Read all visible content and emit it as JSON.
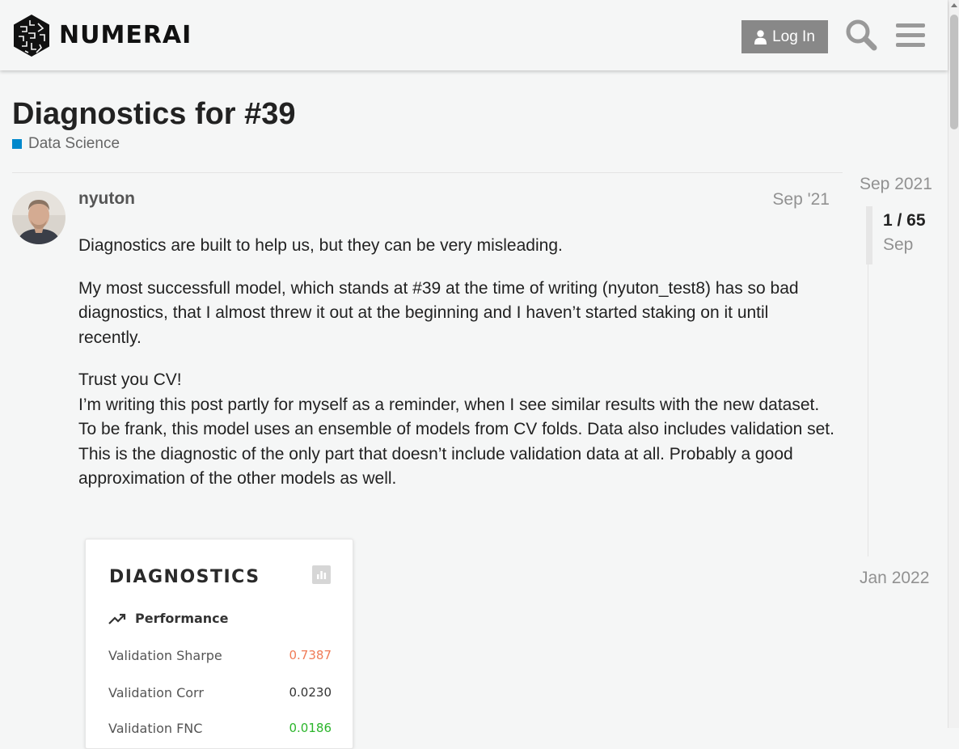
{
  "header": {
    "logo_text": "NUMERAI",
    "login_label": "Log In",
    "icons": {
      "login": "user-icon",
      "search": "search-icon",
      "menu": "hamburger-menu-icon"
    }
  },
  "topic": {
    "title": "Diagnostics for #39",
    "category": "Data Science",
    "category_color": "#0088cc"
  },
  "post": {
    "author": "nyuton",
    "date": "Sep '21",
    "paragraphs": [
      "Diagnostics are built to help us, but they can be very misleading.",
      "My most successfull model, which stands at #39 at the time of writing (nyuton_test8) has so bad diagnostics, that I almost threw it out at the beginning and I haven’t started staking on it until recently."
    ],
    "lines": [
      "Trust you CV!",
      "I’m writing this post partly for myself as a reminder, when I see similar results with the new dataset.",
      "To be frank, this model uses an ensemble of models from CV folds. Data also includes validation set. This is the diagnostic of the only part that doesn’t include validation data at all. Probably a good approximation of the other models as well."
    ]
  },
  "diagnostics": {
    "title": "DIAGNOSTICS",
    "section": "Performance",
    "rows": [
      {
        "label": "Validation Sharpe",
        "value": "0.7387",
        "color": "#f07b57"
      },
      {
        "label": "Validation Corr",
        "value": "0.0230",
        "color": "#333333"
      },
      {
        "label": "Validation FNC",
        "value": "0.0186",
        "color": "#2bb52b"
      }
    ]
  },
  "timeline": {
    "start": "Sep 2021",
    "position": "1 / 65",
    "current_month": "Sep",
    "end": "Jan 2022"
  }
}
